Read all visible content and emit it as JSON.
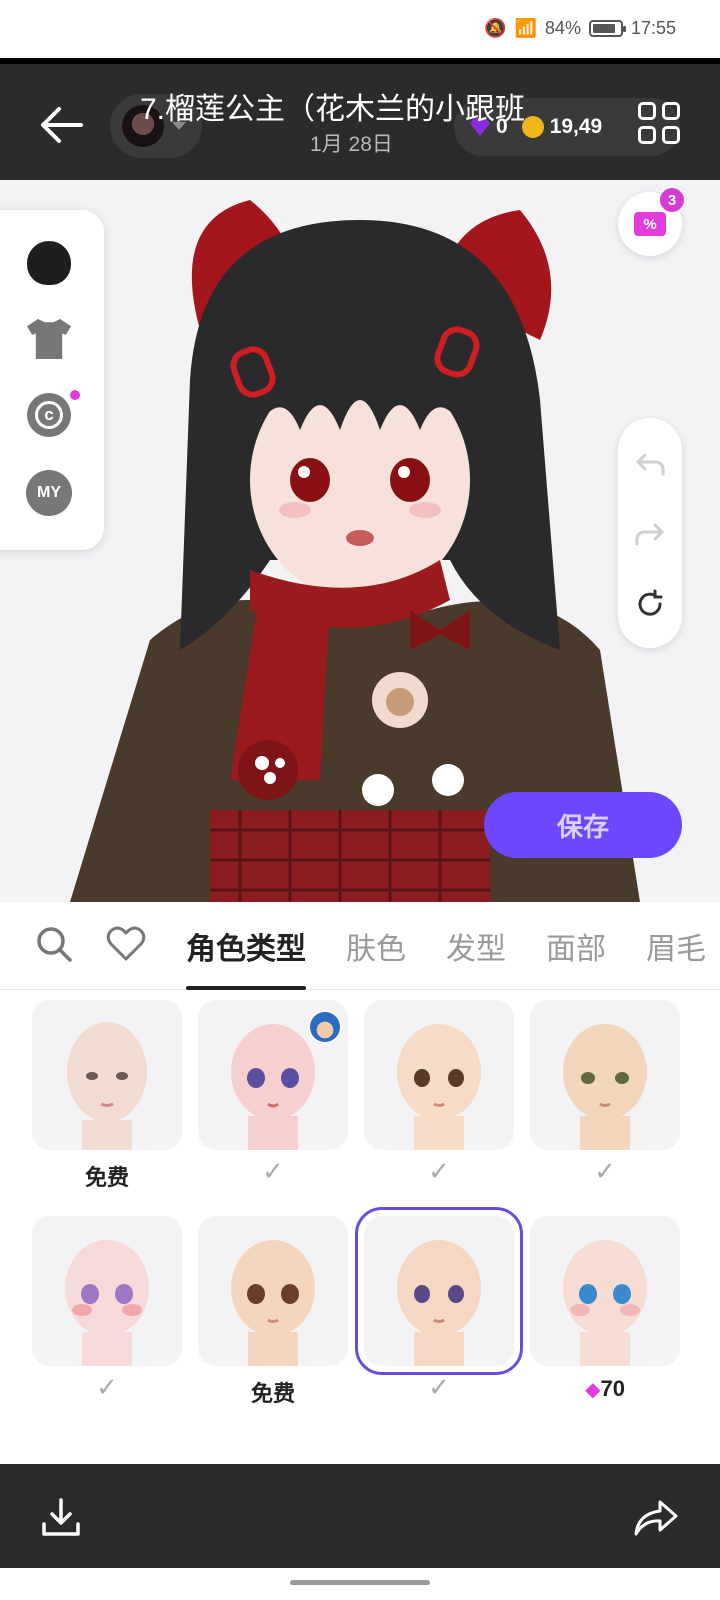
{
  "status_bar": {
    "battery": "84%",
    "time": "17:55",
    "battery_level": 0.84
  },
  "header": {
    "title": "7.榴莲公主（花木兰的小跟班",
    "date": "1月 28日",
    "gems": "0",
    "coins": "19,49"
  },
  "coupon": {
    "badge": "3",
    "icon": "coupon-icon"
  },
  "side_tools": [
    "head-icon",
    "shirt-icon",
    "copyright-icon",
    "my-icon"
  ],
  "side_tools_my_label": "MY",
  "save_button": "保存",
  "tabs": [
    "角色类型",
    "肤色",
    "发型",
    "面部",
    "眉毛"
  ],
  "active_tab": "角色类型",
  "grid": [
    {
      "label": "免费",
      "type": "text"
    },
    {
      "label": "✓",
      "type": "check"
    },
    {
      "label": "✓",
      "type": "check"
    },
    {
      "label": "✓",
      "type": "check"
    },
    {
      "label": "✓",
      "type": "check"
    },
    {
      "label": "免费",
      "type": "text"
    },
    {
      "label": "✓",
      "type": "check",
      "selected": true
    },
    {
      "label": "70",
      "type": "price"
    }
  ],
  "colors": {
    "accent": "#6c47ff",
    "gem": "#e23cdc",
    "bar": "#2b2b2b"
  }
}
